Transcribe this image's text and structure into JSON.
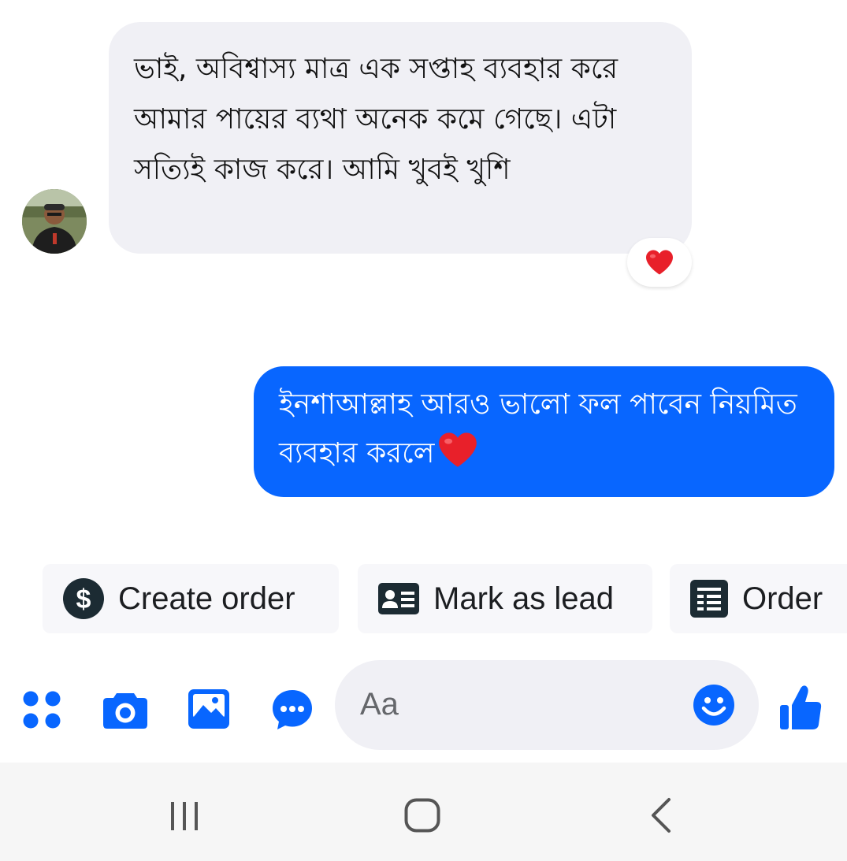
{
  "conversation": {
    "incoming": {
      "text": "ভাই, অবিশ্বাস্য মাত্র এক সপ্তাহ ব্যবহার করে আমার পায়ের ব্যথা অনেক কমে গেছে। এটা সত্যিই কাজ করে। আমি খুবই খুশি",
      "reaction": "heart-emoji"
    },
    "outgoing": {
      "text": "ইনশাআল্লাহ আরও ভালো ফল পাবেন নিয়মিত ব্যবহার করলে",
      "emoji": "heart-emoji"
    }
  },
  "actions": [
    {
      "label": "Create order",
      "icon": "dollar-icon"
    },
    {
      "label": "Mark as lead",
      "icon": "contact-card-icon"
    },
    {
      "label": "Order",
      "icon": "order-list-icon"
    }
  ],
  "composer": {
    "placeholder": "Aa",
    "icons": [
      "apps-icon",
      "camera-icon",
      "gallery-icon",
      "chat-icon",
      "emoji-icon",
      "thumbs-up-icon"
    ]
  },
  "colors": {
    "accent": "#0866ff",
    "incoming_bubble": "#f0f0f5",
    "heart": "#e8202a"
  },
  "navbar": {
    "buttons": [
      "recents-icon",
      "home-icon",
      "back-icon"
    ]
  }
}
